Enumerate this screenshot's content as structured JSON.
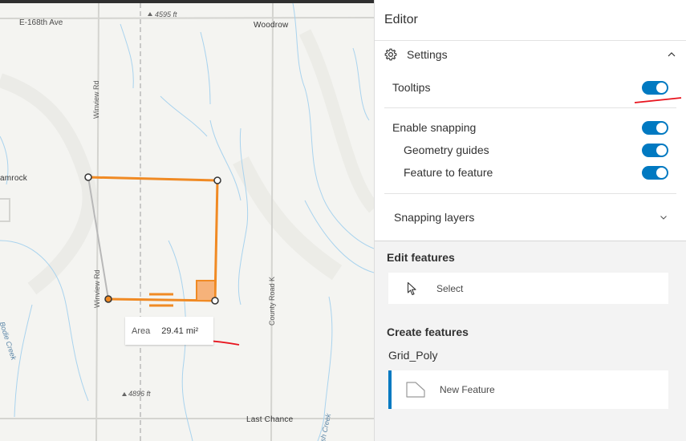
{
  "map": {
    "labels": {
      "street_top": "E-168th Ave",
      "peak_top": "4595 ft",
      "town_woodrow": "Woodrow",
      "road_winview_upper": "Winview Rd",
      "town_shamrock": "amrock",
      "road_winview_lower": "Winview Rd",
      "road_county_k": "County Road K",
      "creek_left": "Bodie Creek",
      "peak_bottom": "4896 ft",
      "town_last_chance": "Last Chance",
      "creek_bottom": "sh Creek"
    },
    "tooltip": {
      "label": "Area",
      "value": "29.41 mi²"
    },
    "sketch_color": "#f08a24"
  },
  "panel": {
    "title": "Editor",
    "settings": {
      "label": "Settings",
      "icon": "gear-icon",
      "expanded": true,
      "tooltips_label": "Tooltips",
      "tooltips_on": true,
      "enable_snapping_label": "Enable snapping",
      "enable_snapping_on": true,
      "geometry_guides_label": "Geometry guides",
      "geometry_guides_on": true,
      "feature_to_feature_label": "Feature to feature",
      "feature_to_feature_on": true,
      "snapping_layers_label": "Snapping layers"
    },
    "edit_features": {
      "title": "Edit features",
      "select_label": "Select",
      "select_icon": "cursor-icon"
    },
    "create_features": {
      "title": "Create features",
      "layer_name": "Grid_Poly",
      "new_feature_label": "New Feature",
      "new_feature_icon": "polygon-icon"
    },
    "accent_color": "#0079c1"
  },
  "annotation_color": "#e8141e"
}
